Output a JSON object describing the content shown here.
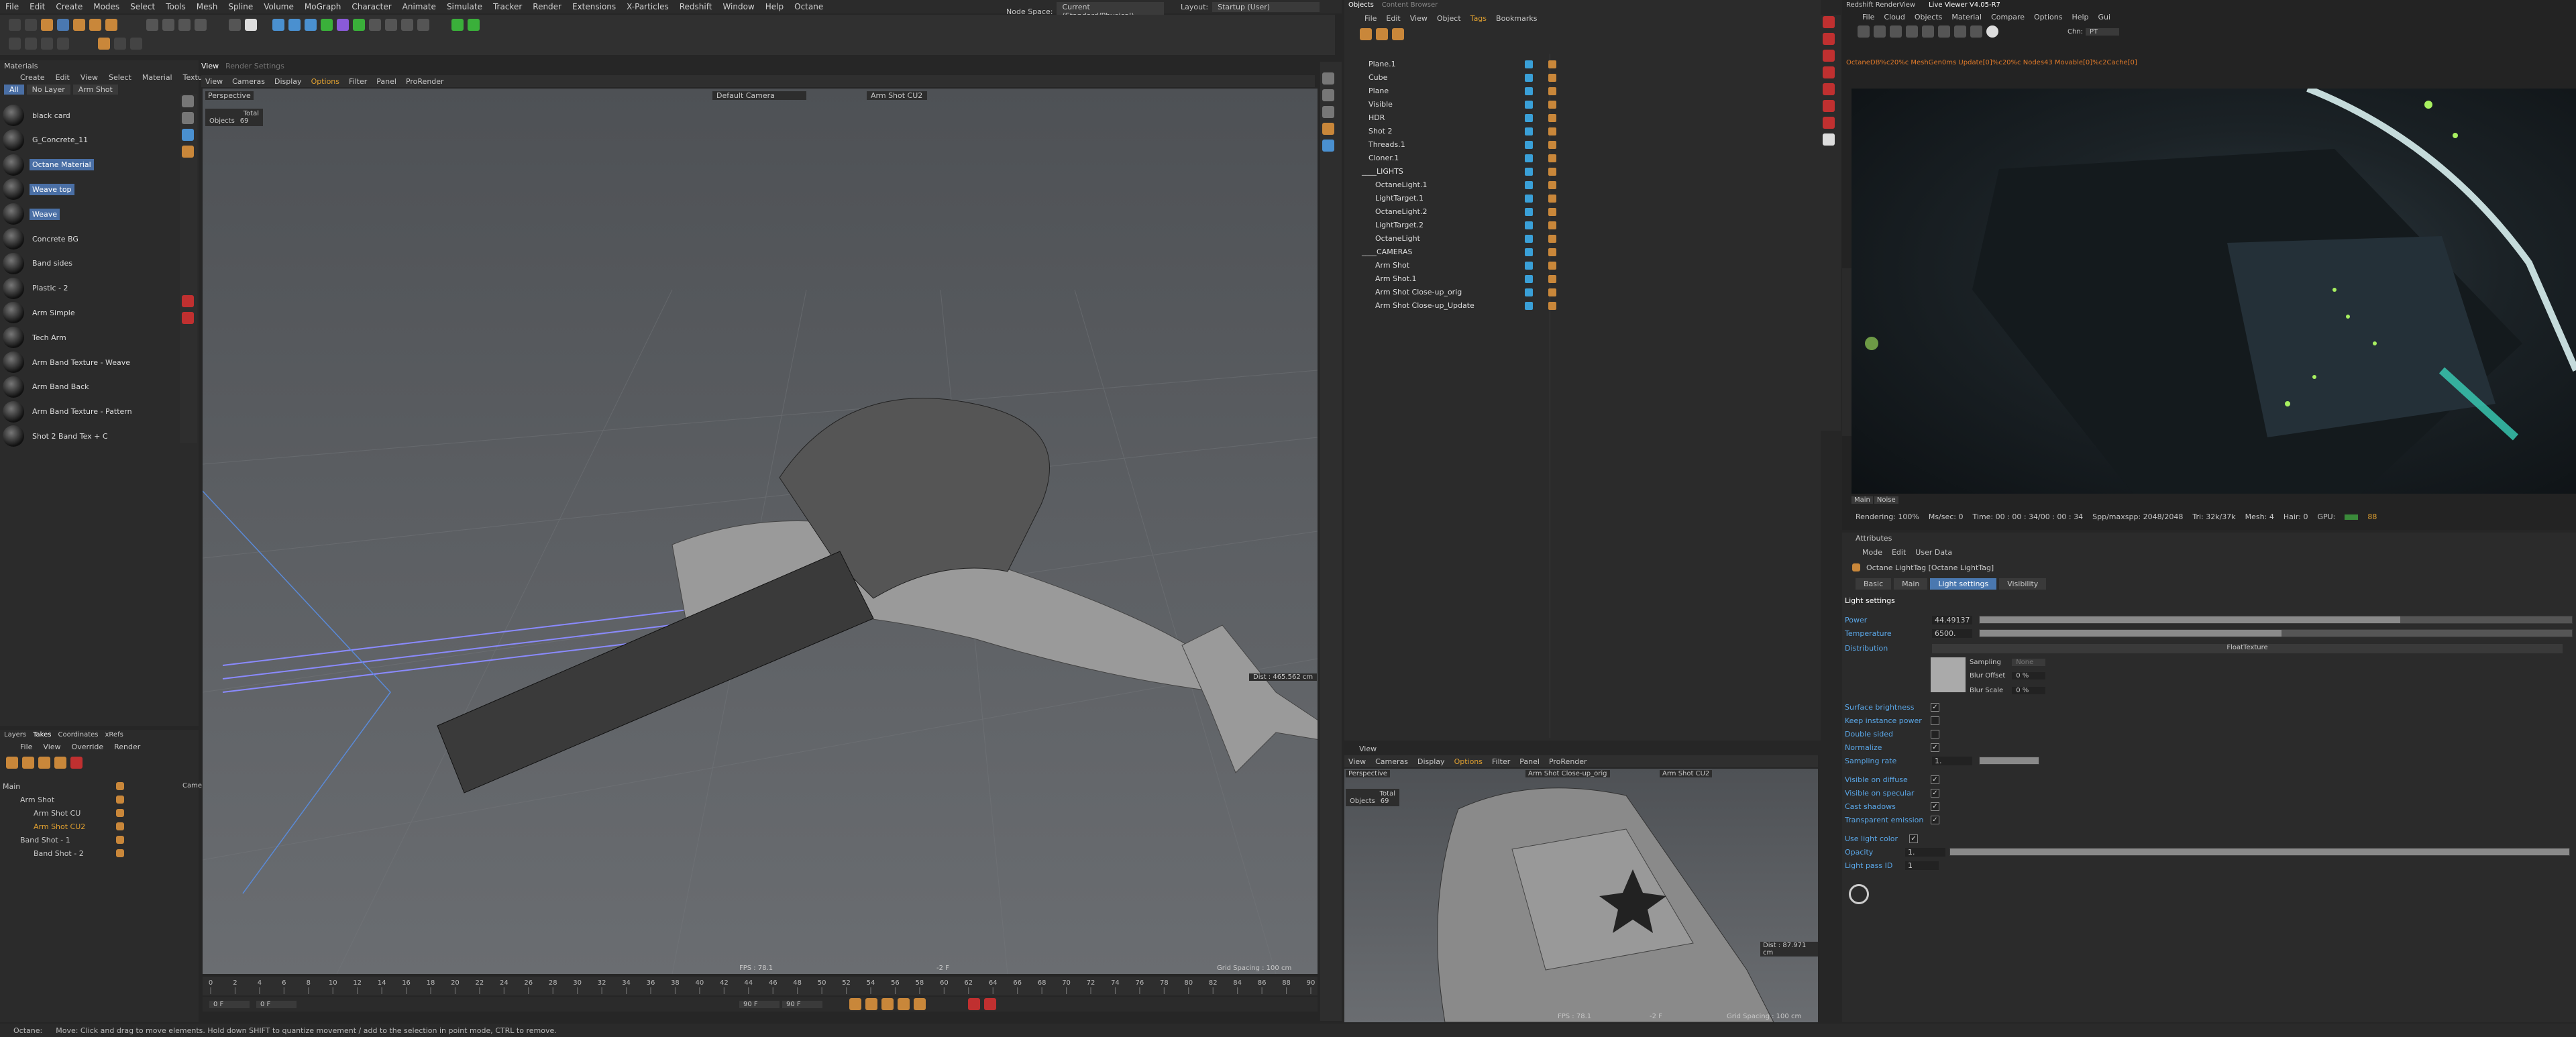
{
  "menubar": {
    "items": [
      "File",
      "Edit",
      "Create",
      "Modes",
      "Select",
      "Tools",
      "Mesh",
      "Spline",
      "Volume",
      "MoGraph",
      "Character",
      "Animate",
      "Simulate",
      "Tracker",
      "Render",
      "Extensions",
      "X-Particles",
      "Redshift",
      "Window",
      "Help",
      "Octane"
    ],
    "node_space_label": "Node Space:",
    "node_space_value": "Current (Standard/Physical)",
    "layout_label": "Layout:",
    "layout_value": "Startup (User)"
  },
  "materials": {
    "panel_title": "Materials",
    "menu": [
      "Create",
      "Edit",
      "View",
      "Select",
      "Material",
      "Texture"
    ],
    "filters": [
      "All",
      "No Layer",
      "Arm Shot"
    ],
    "items": [
      {
        "name": "black card",
        "selected": false
      },
      {
        "name": "G_Concrete_11",
        "selected": false
      },
      {
        "name": "Octane Material",
        "selected": true
      },
      {
        "name": "Weave top",
        "selected": true
      },
      {
        "name": "Weave",
        "selected": true
      },
      {
        "name": "Concrete BG",
        "selected": false
      },
      {
        "name": "Band sides",
        "selected": false
      },
      {
        "name": "Plastic - 2",
        "selected": false
      },
      {
        "name": "Arm Simple",
        "selected": false
      },
      {
        "name": "Tech Arm",
        "selected": false
      },
      {
        "name": "Arm Band Texture - Weave",
        "selected": false
      },
      {
        "name": "Arm Band Back",
        "selected": false
      },
      {
        "name": "Arm Band Texture - Pattern",
        "selected": false
      },
      {
        "name": "Shot 2 Band Tex + C",
        "selected": false
      }
    ]
  },
  "layers": {
    "tabs": [
      "Layers",
      "Takes",
      "Coordinates",
      "xRefs"
    ],
    "menu": [
      "File",
      "View",
      "Override",
      "Render"
    ],
    "rows": [
      "Main",
      "Arm Shot",
      "Arm Shot CU",
      "Arm Shot CU2",
      "Band Shot - 1",
      "Band Shot - 2"
    ],
    "col_label": "Came"
  },
  "viewport_main": {
    "tabs": [
      "View",
      "Render Settings"
    ],
    "menu": [
      "View",
      "Cameras",
      "Display",
      "Options",
      "Filter",
      "Panel",
      "ProRender"
    ],
    "label": "Perspective",
    "camera": "Default Camera",
    "take": "Arm Shot CU2",
    "stats_title": "Total",
    "objects_label": "Objects",
    "objects_value": "69",
    "dist": "Dist : 465.562 cm",
    "fps": "FPS : 78.1",
    "frame": "-2 F",
    "grid": "Grid Spacing : 100 cm"
  },
  "timeline": {
    "ticks": [
      "0",
      "2",
      "4",
      "6",
      "8",
      "10",
      "12",
      "14",
      "16",
      "18",
      "20",
      "22",
      "24",
      "26",
      "28",
      "30",
      "32",
      "34",
      "36",
      "38",
      "40",
      "42",
      "44",
      "46",
      "48",
      "50",
      "52",
      "54",
      "56",
      "58",
      "60",
      "62",
      "64",
      "66",
      "68",
      "70",
      "72",
      "74",
      "76",
      "78",
      "80",
      "82",
      "84",
      "86",
      "88",
      "90"
    ],
    "start": "0 F",
    "start2": "0 F",
    "end": "90 F",
    "end2": "90 F"
  },
  "objects": {
    "tabs": [
      "Objects",
      "Content Browser"
    ],
    "menu": [
      "File",
      "Edit",
      "View",
      "Object",
      "Tags",
      "Bookmarks"
    ],
    "rows": [
      {
        "name": "Plane.1",
        "indent": 1
      },
      {
        "name": "Cube",
        "indent": 1
      },
      {
        "name": "Plane",
        "indent": 1
      },
      {
        "name": "Visible",
        "indent": 1
      },
      {
        "name": "HDR",
        "indent": 1
      },
      {
        "name": "Shot 2",
        "indent": 1
      },
      {
        "name": "Threads.1",
        "indent": 1
      },
      {
        "name": "Cloner.1",
        "indent": 1
      },
      {
        "name": "____LIGHTS",
        "indent": 0
      },
      {
        "name": "OctaneLight.1",
        "indent": 2
      },
      {
        "name": "LightTarget.1",
        "indent": 2
      },
      {
        "name": "OctaneLight.2",
        "indent": 2
      },
      {
        "name": "LightTarget.2",
        "indent": 2
      },
      {
        "name": "OctaneLight",
        "indent": 2
      },
      {
        "name": "____CAMERAS",
        "indent": 0
      },
      {
        "name": "Arm Shot",
        "indent": 2
      },
      {
        "name": "Arm Shot.1",
        "indent": 2
      },
      {
        "name": "Arm Shot Close-up_orig",
        "indent": 2
      },
      {
        "name": "Arm Shot Close-up_Update",
        "indent": 2
      }
    ]
  },
  "viewport_small": {
    "tab": "View",
    "menu": [
      "View",
      "Cameras",
      "Display",
      "Options",
      "Filter",
      "Panel",
      "ProRender"
    ],
    "label": "Perspective",
    "camera": "Arm Shot Close-up_orig",
    "take": "Arm Shot CU2",
    "stats_title": "Total",
    "objects_label": "Objects",
    "objects_value": "69",
    "dist": "Dist : 87.971 cm",
    "fps": "FPS : 78.1",
    "frame": "-2 F",
    "grid": "Grid Spacing : 100 cm"
  },
  "liveviewer": {
    "title": "Redshift RenderView",
    "title2": "Live Viewer V4.05-R7",
    "menu": [
      "File",
      "Cloud",
      "Objects",
      "Material",
      "Compare",
      "Options",
      "Help",
      "Gui"
    ],
    "chn_label": "Chn:",
    "chn_value": "PT",
    "status_line": "OctaneDB%c20%c MeshGen0ms  Update[0]%c20%c  Nodes43  Movable[0]%c2Cache[0]",
    "tabs": [
      "Main",
      "Noise"
    ],
    "stats": {
      "rendering": "Rendering: 100%",
      "ms_sec": "Ms/sec: 0",
      "time": "Time: 00 : 00 : 34/00 : 00 : 34",
      "spp": "Spp/maxspp: 2048/2048",
      "tri": "Tri: 32k/37k",
      "mesh": "Mesh: 4",
      "hair": "Hair: 0",
      "gpu": "GPU:",
      "gpu_value": "88"
    }
  },
  "attributes": {
    "panel_title": "Attributes",
    "menu": [
      "Mode",
      "Edit",
      "User Data"
    ],
    "tag_title": "Octane LightTag [Octane LightTag]",
    "tabs": [
      {
        "label": "Basic",
        "active": false
      },
      {
        "label": "Main",
        "active": false
      },
      {
        "label": "Light settings",
        "active": true
      },
      {
        "label": "Visibility",
        "active": false
      }
    ],
    "section": "Light settings",
    "power_label": "Power",
    "power_value": "44.49137",
    "power_fill": 0.71,
    "temperature_label": "Temperature",
    "temperature_value": "6500.",
    "temperature_fill": 0.51,
    "distribution_label": "Distribution",
    "distribution_value": "FloatTexture",
    "sampling_label": "Sampling",
    "sampling_value": "None",
    "blur_offset_label": "Blur Offset",
    "blur_offset_value": "0 %",
    "blur_scale_label": "Blur Scale",
    "blur_scale_value": "0 %",
    "checkboxes": [
      {
        "label": "Surface brightness",
        "checked": true
      },
      {
        "label": "Keep instance power",
        "checked": false
      },
      {
        "label": "Double sided",
        "checked": false
      },
      {
        "label": "Normalize",
        "checked": true
      }
    ],
    "sampling_rate_label": "Sampling rate",
    "sampling_rate_value": "1.",
    "vis_checkboxes": [
      {
        "label": "Visible on diffuse",
        "checked": true
      },
      {
        "label": "Visible on specular",
        "checked": true
      },
      {
        "label": "Cast shadows",
        "checked": true
      },
      {
        "label": "Transparent emission",
        "checked": true
      }
    ],
    "use_light_color_label": "Use light color",
    "use_light_color_checked": true,
    "opacity_label": "Opacity",
    "opacity_value": "1.",
    "opacity_fill": 1.0,
    "light_pass_label": "Light pass ID",
    "light_pass_value": "1"
  },
  "statusbar": {
    "app": "Octane:",
    "hint": "Move: Click and drag to move elements. Hold down SHIFT to quantize movement / add to the selection in point mode, CTRL to remove."
  }
}
